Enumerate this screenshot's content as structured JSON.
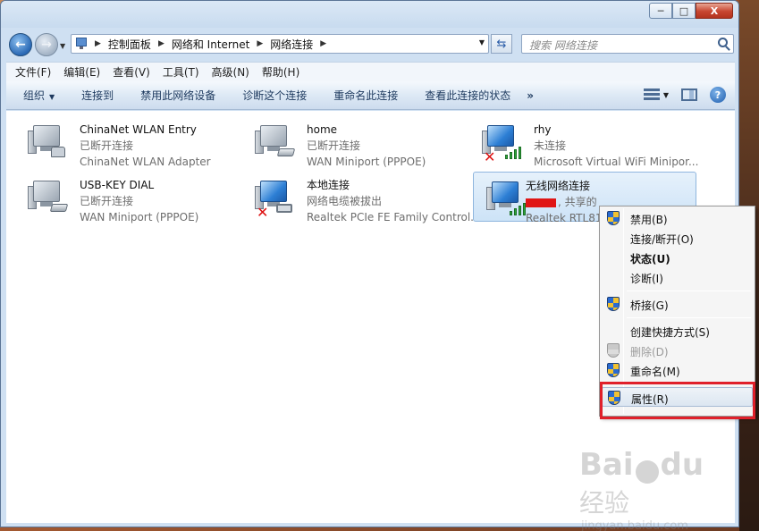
{
  "window": {
    "caption": {
      "minimize": "─",
      "maximize": "□",
      "close": "X"
    }
  },
  "address": {
    "crumbs": [
      "控制面板",
      "网络和 Internet",
      "网络连接"
    ],
    "search_placeholder": "搜索 网络连接"
  },
  "menubar": {
    "items": [
      "文件(F)",
      "编辑(E)",
      "查看(V)",
      "工具(T)",
      "高级(N)",
      "帮助(H)"
    ]
  },
  "toolbar": {
    "items": [
      "组织",
      "连接到",
      "禁用此网络设备",
      "诊断这个连接",
      "重命名此连接",
      "查看此连接的状态"
    ],
    "more": "»"
  },
  "connections": [
    {
      "name": "ChinaNet WLAN Entry",
      "status": "已断开连接",
      "device": "ChinaNet WLAN Adapter"
    },
    {
      "name": "home",
      "status": "已断开连接",
      "device": "WAN Miniport (PPPOE)"
    },
    {
      "name": "rhy",
      "status": "未连接",
      "device": "Microsoft Virtual WiFi Minipor..."
    },
    {
      "name": "USB-KEY DIAL",
      "status": "已断开连接",
      "device": "WAN Miniport (PPPOE)"
    },
    {
      "name": "本地连接",
      "status": "网络电缆被拔出",
      "device": "Realtek PCIe FE Family Control..."
    },
    {
      "name": "无线网络连接",
      "status": ", 共享的",
      "device": "Realtek RTL81"
    }
  ],
  "context_menu": {
    "items": [
      "禁用(B)",
      "连接/断开(O)",
      "状态(U)",
      "诊断(I)",
      "桥接(G)",
      "创建快捷方式(S)",
      "删除(D)",
      "重命名(M)",
      "属性(R)"
    ]
  },
  "watermark": {
    "logo": "Bai",
    "logo_tail": "du",
    "cn": "经验",
    "url": "jingyan.baidu.com"
  }
}
